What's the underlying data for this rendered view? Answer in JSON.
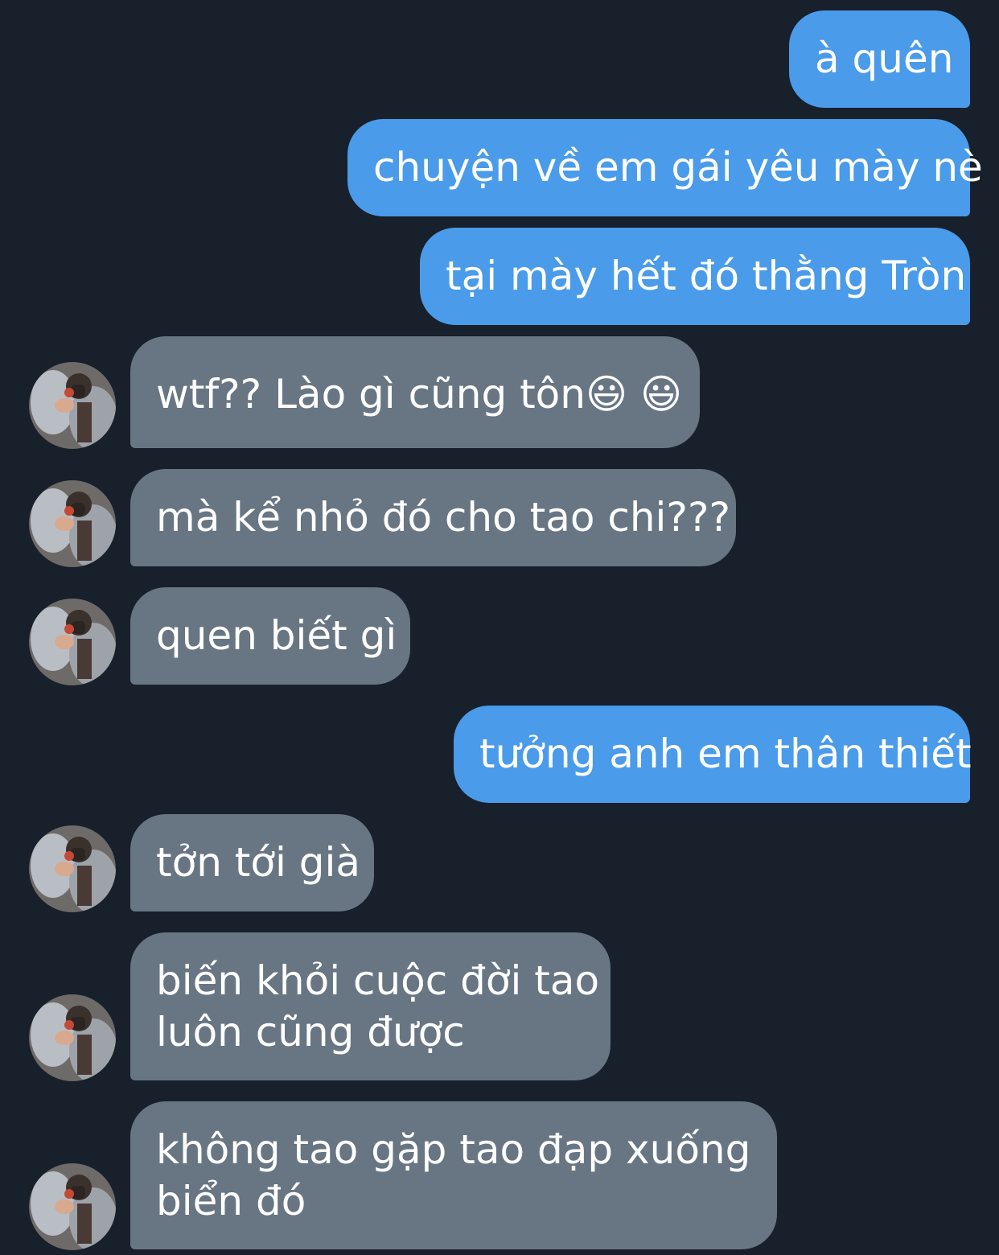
{
  "conversation": {
    "messages": [
      {
        "side": "sent",
        "text": "à quên"
      },
      {
        "side": "sent",
        "text": "chuyện về em gái yêu mày nè"
      },
      {
        "side": "sent",
        "text": "tại mày hết đó thằng Tròn"
      },
      {
        "side": "received",
        "text": "wtf?? Lào gì cũng tôn😃 😃",
        "avatar": "contact-avatar"
      },
      {
        "side": "received",
        "text": "mà kể nhỏ đó cho tao chi???",
        "avatar": "contact-avatar"
      },
      {
        "side": "received",
        "text": "quen biết gì",
        "avatar": "contact-avatar"
      },
      {
        "side": "sent",
        "text": "tưởng anh em thân thiết"
      },
      {
        "side": "received",
        "text": "tởn tới già",
        "avatar": "contact-avatar"
      },
      {
        "side": "received",
        "lines": [
          "biến khỏi cuộc đời tao",
          "luôn cũng được"
        ],
        "avatar": "contact-avatar"
      },
      {
        "side": "received",
        "lines": [
          "không tao gặp tao đạp xuống",
          "biển đó"
        ],
        "avatar": "contact-avatar"
      }
    ]
  },
  "colors": {
    "background": "#17202b",
    "sent_bubble": "#4a9be9",
    "received_bubble": "#687583",
    "text": "#ffffff"
  }
}
